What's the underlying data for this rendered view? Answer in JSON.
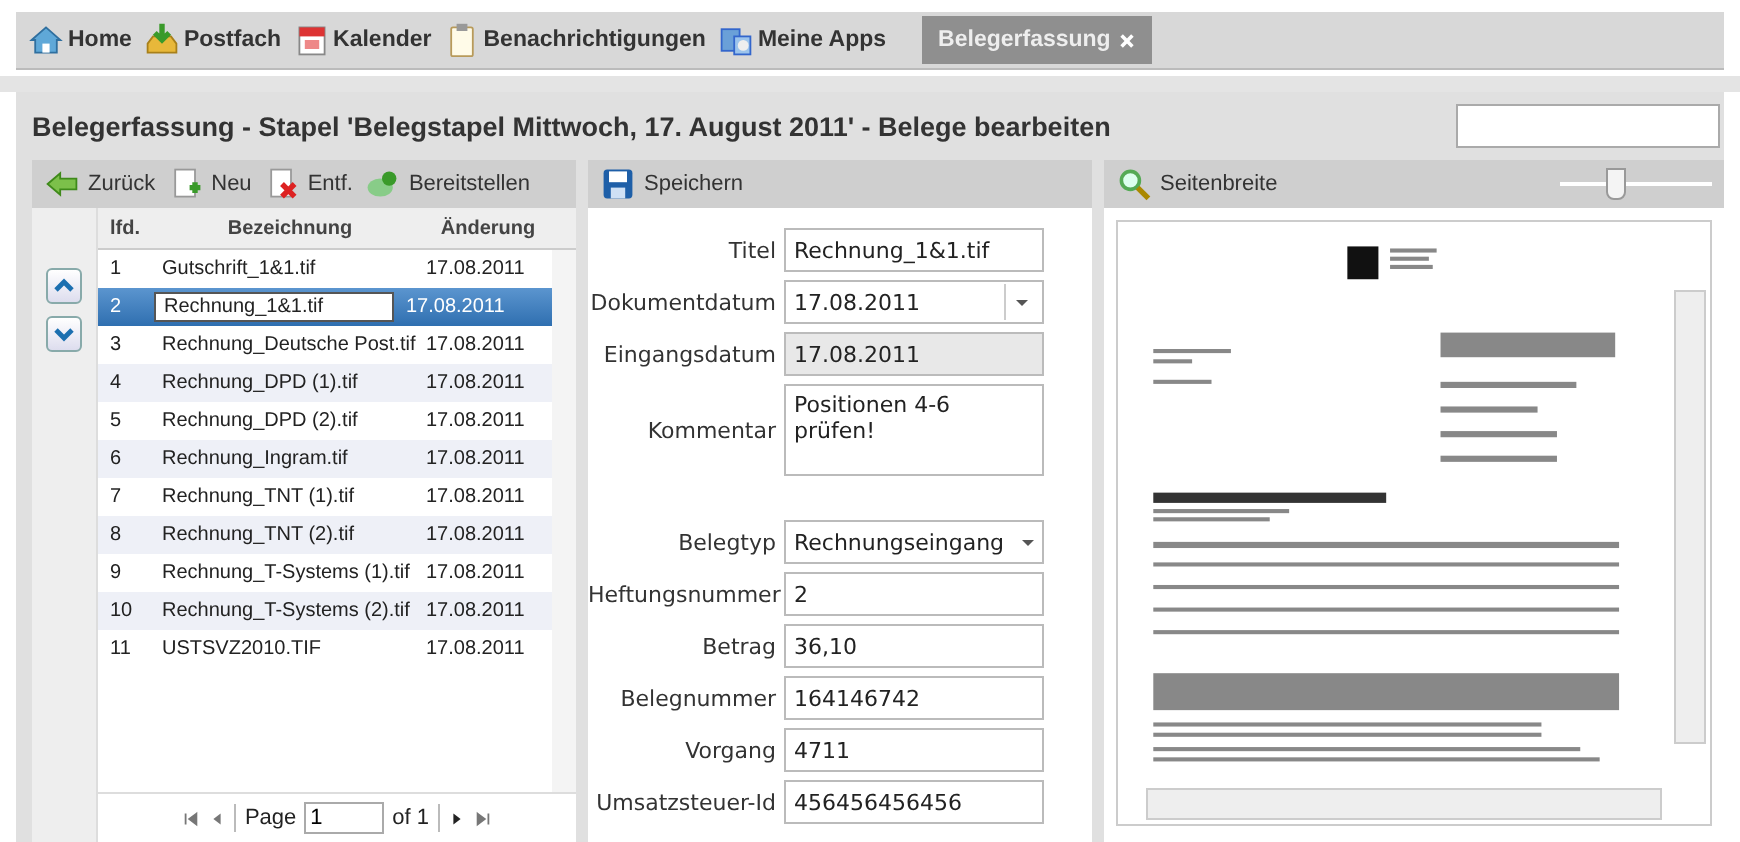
{
  "nav_tabs": [
    {
      "label": "Home",
      "selected": false
    },
    {
      "label": "Postfach",
      "selected": false
    },
    {
      "label": "Kalender",
      "selected": false
    },
    {
      "label": "Benachrichtigungen",
      "selected": false
    },
    {
      "label": "Meine Apps",
      "selected": false
    },
    {
      "label": "Belegerfassung",
      "selected": true
    }
  ],
  "header": {
    "title": "Belegerfassung - Stapel 'Belegstapel Mittwoch, 17. August 2011' - Belege bearbeiten"
  },
  "list_toolbar": [
    {
      "label": "Zurück"
    },
    {
      "label": "Neu"
    },
    {
      "label": "Entf."
    },
    {
      "label": "Bereitstellen"
    }
  ],
  "table": {
    "columns": [
      "lfd.",
      "Bezeichnung",
      "Änderung"
    ],
    "rows": [
      {
        "nr": "1",
        "name": "Gutschrift_1&1.tif",
        "date": "17.08.2011",
        "selected": false,
        "editing": false
      },
      {
        "nr": "2",
        "name": "Rechnung_1&1.tif",
        "date": "17.08.2011",
        "selected": true,
        "editing": true
      },
      {
        "nr": "3",
        "name": "Rechnung_Deutsche Post.tif",
        "date": "17.08.2011",
        "selected": false,
        "editing": false
      },
      {
        "nr": "4",
        "name": "Rechnung_DPD (1).tif",
        "date": "17.08.2011",
        "selected": false,
        "editing": false
      },
      {
        "nr": "5",
        "name": "Rechnung_DPD (2).tif",
        "date": "17.08.2011",
        "selected": false,
        "editing": false
      },
      {
        "nr": "6",
        "name": "Rechnung_Ingram.tif",
        "date": "17.08.2011",
        "selected": false,
        "editing": false
      },
      {
        "nr": "7",
        "name": "Rechnung_TNT (1).tif",
        "date": "17.08.2011",
        "selected": false,
        "editing": false
      },
      {
        "nr": "8",
        "name": "Rechnung_TNT (2).tif",
        "date": "17.08.2011",
        "selected": false,
        "editing": false
      },
      {
        "nr": "9",
        "name": "Rechnung_T-Systems (1).tif",
        "date": "17.08.2011",
        "selected": false,
        "editing": false
      },
      {
        "nr": "10",
        "name": "Rechnung_T-Systems (2).tif",
        "date": "17.08.2011",
        "selected": false,
        "editing": false
      },
      {
        "nr": "11",
        "name": "USTSVZ2010.TIF",
        "date": "17.08.2011",
        "selected": false,
        "editing": false
      }
    ]
  },
  "pager": {
    "page_label": "Page",
    "page": "1",
    "of_label": "of 1"
  },
  "form": {
    "save_label": "Speichern",
    "fields": [
      {
        "label": "Titel",
        "value": "Rechnung_1&1.tif",
        "kind": "text"
      },
      {
        "label": "Dokumentdatum",
        "value": "17.08.2011",
        "kind": "date"
      },
      {
        "label": "Eingangsdatum",
        "value": "17.08.2011",
        "kind": "readonly"
      },
      {
        "label": "Kommentar",
        "value": "Positionen 4-6 prüfen!",
        "kind": "textarea"
      },
      {
        "label": "Belegtyp",
        "value": "Rechnungseingang",
        "kind": "select"
      },
      {
        "label": "Heftungsnummer",
        "value": "2",
        "kind": "text"
      },
      {
        "label": "Betrag",
        "value": "36,10",
        "kind": "text"
      },
      {
        "label": "Belegnummer",
        "value": "164146742",
        "kind": "text"
      },
      {
        "label": "Vorgang",
        "value": "4711",
        "kind": "text"
      },
      {
        "label": "Umsatzsteuer-Id",
        "value": "456456456456",
        "kind": "text"
      }
    ]
  },
  "viewer": {
    "fit_label": "Seitenbreite",
    "zoom": {
      "level": 0.35
    }
  }
}
